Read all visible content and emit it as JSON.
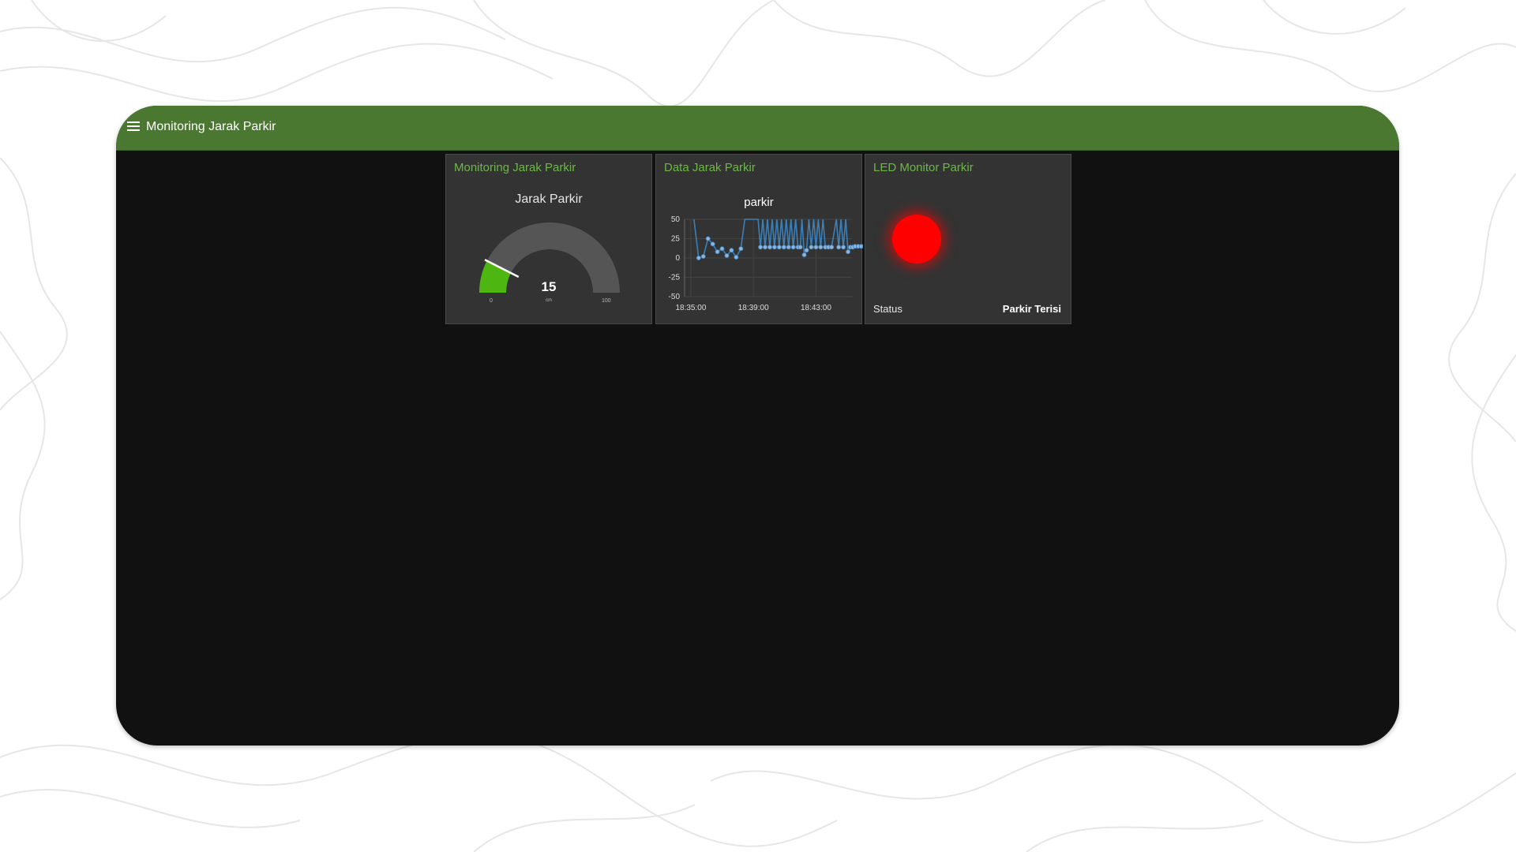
{
  "app": {
    "title": "Monitoring Jarak Parkir"
  },
  "colors": {
    "topbar": "#4b7831",
    "card_title": "#6bb944",
    "gauge_fill": "#4db610",
    "gauge_track": "#555555",
    "line": "#3a7fb8",
    "led_on": "#ff0000"
  },
  "gauge": {
    "card_title": "Monitoring Jarak Parkir",
    "label": "Jarak Parkir",
    "value": 15,
    "value_text": "15",
    "unit": "cm",
    "min": 0,
    "min_text": "0",
    "max": 100,
    "max_text": "100"
  },
  "chart": {
    "card_title": "Data Jarak Parkir",
    "series_name": "parkir",
    "y_ticks": [
      "50",
      "25",
      "0",
      "-25",
      "-50"
    ],
    "x_ticks": [
      "18:35:00",
      "18:39:00",
      "18:43:00"
    ]
  },
  "chart_data": {
    "type": "line",
    "series": [
      {
        "name": "parkir",
        "points": [
          [
            0.2,
            50
          ],
          [
            0.5,
            0
          ],
          [
            0.8,
            2
          ],
          [
            1.1,
            25
          ],
          [
            1.4,
            18
          ],
          [
            1.7,
            8
          ],
          [
            2.0,
            12
          ],
          [
            2.3,
            3
          ],
          [
            2.6,
            10
          ],
          [
            2.9,
            1
          ],
          [
            3.2,
            12
          ],
          [
            3.45,
            50
          ],
          [
            4.3,
            50
          ],
          [
            4.45,
            14
          ],
          [
            4.6,
            50
          ],
          [
            4.75,
            14
          ],
          [
            4.9,
            50
          ],
          [
            5.05,
            14
          ],
          [
            5.2,
            50
          ],
          [
            5.35,
            14
          ],
          [
            5.5,
            50
          ],
          [
            5.65,
            14
          ],
          [
            5.8,
            50
          ],
          [
            5.95,
            14
          ],
          [
            6.1,
            50
          ],
          [
            6.25,
            14
          ],
          [
            6.4,
            50
          ],
          [
            6.55,
            14
          ],
          [
            6.7,
            50
          ],
          [
            6.85,
            14
          ],
          [
            7.0,
            14
          ],
          [
            7.1,
            50
          ],
          [
            7.25,
            4
          ],
          [
            7.4,
            10
          ],
          [
            7.55,
            50
          ],
          [
            7.7,
            14
          ],
          [
            7.85,
            50
          ],
          [
            8.0,
            14
          ],
          [
            8.15,
            50
          ],
          [
            8.3,
            14
          ],
          [
            8.45,
            50
          ],
          [
            8.6,
            14
          ],
          [
            8.8,
            14
          ],
          [
            9.0,
            14
          ],
          [
            9.3,
            50
          ],
          [
            9.45,
            14
          ],
          [
            9.6,
            50
          ],
          [
            9.75,
            14
          ],
          [
            9.9,
            50
          ],
          [
            10.05,
            8
          ],
          [
            10.2,
            14
          ],
          [
            10.35,
            14
          ],
          [
            10.5,
            15
          ],
          [
            10.7,
            15
          ],
          [
            10.9,
            15
          ],
          [
            11.1,
            15
          ],
          [
            11.3,
            16
          ]
        ]
      }
    ],
    "x_ticks": [
      "18:35:00",
      "18:39:00",
      "18:43:00"
    ],
    "x_tick_minutes": [
      0,
      4,
      8
    ],
    "x_range_minutes": [
      -0.4,
      10.3
    ],
    "y_ticks": [
      50,
      25,
      0,
      -25,
      -50
    ],
    "ylim": [
      -50,
      50
    ],
    "grid": true
  },
  "led": {
    "card_title": "LED Monitor Parkir",
    "status_label": "Status",
    "status_value": "Parkir Terisi",
    "state": "on"
  }
}
